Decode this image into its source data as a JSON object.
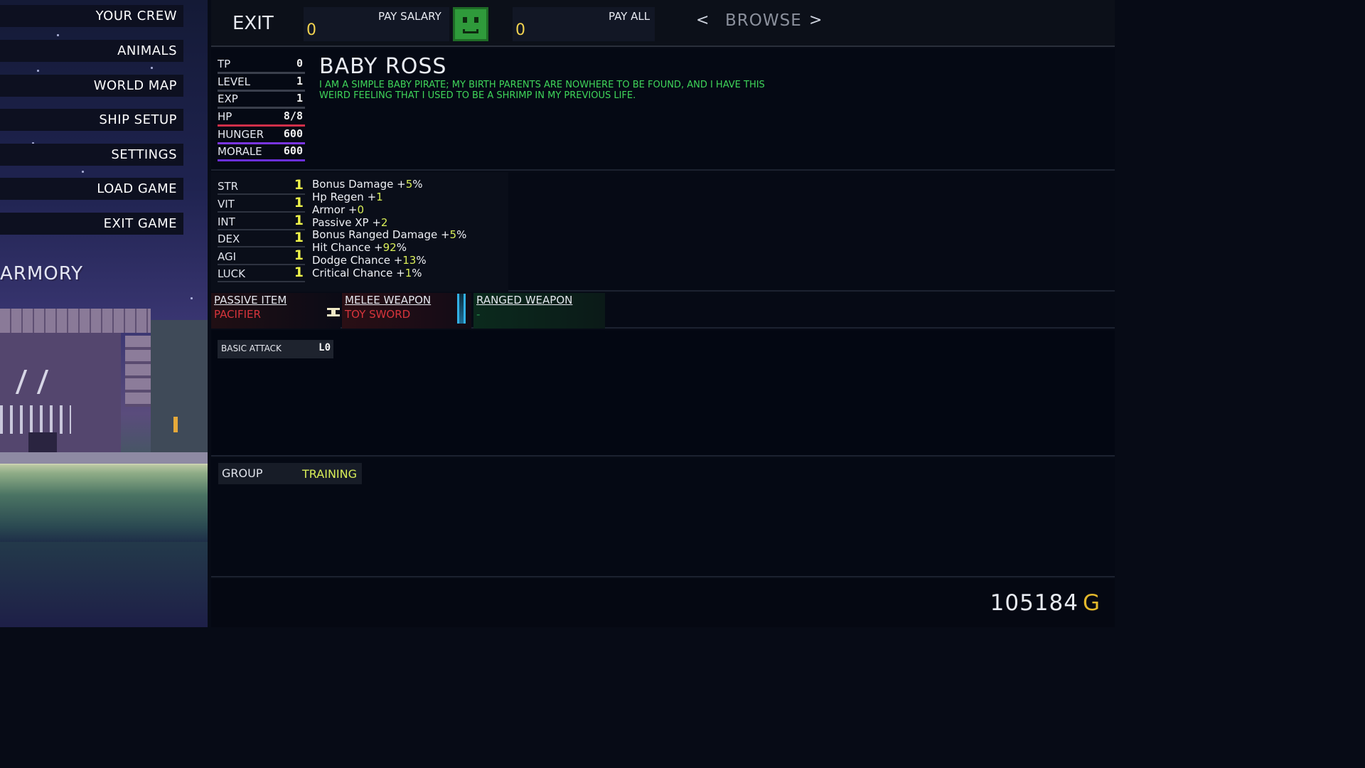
{
  "menu": {
    "items": [
      "YOUR CREW",
      "ANIMALS",
      "WORLD MAP",
      "SHIP SETUP",
      "SETTINGS",
      "LOAD GAME",
      "EXIT GAME"
    ],
    "location_title": "ARMORY"
  },
  "topbar": {
    "exit_label": "EXIT",
    "pay_salary_label": "PAY SALARY",
    "pay_salary_value": "0",
    "mood_icon": "smiley-face-icon",
    "pay_all_label": "PAY ALL",
    "pay_all_value": "0",
    "browse_prev": "<",
    "browse_label": "BROWSE",
    "browse_next": ">"
  },
  "character": {
    "name": "BABY ROSS",
    "description": "I AM A SIMPLE BABY PIRATE; MY BIRTH PARENTS ARE NOWHERE TO BE FOUND, AND I HAVE THIS WEIRD FEELING THAT I USED TO BE A SHRIMP IN MY PREVIOUS LIFE.",
    "stats": [
      {
        "label": "TP",
        "value": "0",
        "bar_color": "#3a3f4c"
      },
      {
        "label": "LEVEL",
        "value": "1",
        "bar_color": "#3a3f4c"
      },
      {
        "label": "EXP",
        "value": "1",
        "bar_color": "#3a3f4c"
      },
      {
        "label": "HP",
        "value": "8/8",
        "bar_color": "#d22f4a"
      },
      {
        "label": "HUNGER",
        "value": "600",
        "bar_color": "#7a35e0"
      },
      {
        "label": "MORALE",
        "value": "600",
        "bar_color": "#6a2fd9"
      }
    ]
  },
  "attributes": [
    {
      "label": "STR",
      "value": "1"
    },
    {
      "label": "VIT",
      "value": "1"
    },
    {
      "label": "INT",
      "value": "1"
    },
    {
      "label": "DEX",
      "value": "1"
    },
    {
      "label": "AGI",
      "value": "1"
    },
    {
      "label": "LUCK",
      "value": "1"
    }
  ],
  "bonuses": [
    {
      "text": "Bonus Damage +",
      "num": "5",
      "suffix": "%"
    },
    {
      "text": "Hp Regen +",
      "num": "1",
      "suffix": ""
    },
    {
      "text": "Armor +",
      "num": "0",
      "suffix": ""
    },
    {
      "text": "Passive XP +",
      "num": "2",
      "suffix": ""
    },
    {
      "text": "Bonus Ranged Damage +",
      "num": "5",
      "suffix": "%"
    },
    {
      "text": "Hit Chance +",
      "num": "92",
      "suffix": "%"
    },
    {
      "text": "Dodge Chance +",
      "num": "13",
      "suffix": "%"
    },
    {
      "text": "Critical Chance +",
      "num": "1",
      "suffix": "%"
    }
  ],
  "equipment": {
    "passive_label": "PASSIVE ITEM",
    "passive_value": "PACIFIER",
    "melee_label": "MELEE WEAPON",
    "melee_value": "TOY SWORD",
    "ranged_label": "RANGED WEAPON",
    "ranged_value": "-"
  },
  "skills": [
    {
      "name": "BASIC ATTACK",
      "level": "L0"
    }
  ],
  "group": {
    "label": "GROUP",
    "value": "TRAINING"
  },
  "gold": {
    "amount": "105184",
    "unit": "G"
  }
}
